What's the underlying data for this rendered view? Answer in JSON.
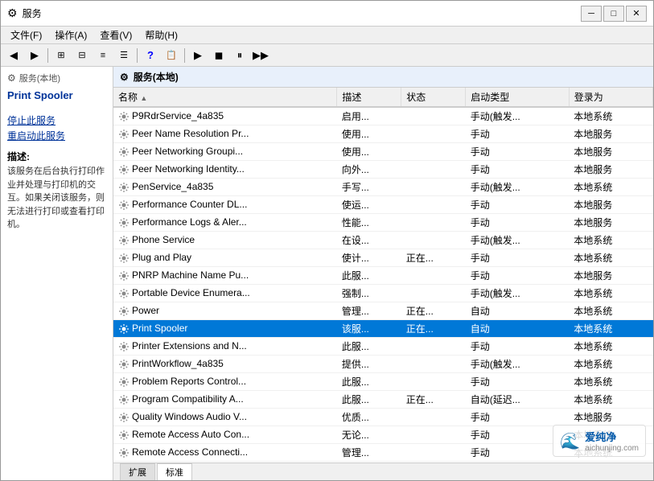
{
  "window": {
    "title": "服务",
    "icon": "⚙"
  },
  "titlebar": {
    "minimize": "─",
    "maximize": "□",
    "close": "✕"
  },
  "menu": {
    "items": [
      "文件(F)",
      "操作(A)",
      "查看(V)",
      "帮助(H)"
    ]
  },
  "sidebar": {
    "header": "服务(本地)",
    "service_title": "Print Spooler",
    "stop_link": "停止此服务",
    "restart_link": "重启动此服务",
    "desc_label": "描述:",
    "desc_text": "该服务在后台执行打印作业并处理与打印机的交互。如果关闭该服务，则无法进行打印或查看打印机。"
  },
  "panel_header": "服务(本地)",
  "columns": [
    "名称",
    "描述",
    "状态",
    "启动类型",
    "登录为"
  ],
  "services": [
    {
      "name": "P9RdrService_4a835",
      "desc": "启用...",
      "status": "",
      "startup": "手动(触发...",
      "login": "本地系统"
    },
    {
      "name": "Peer Name Resolution Pr...",
      "desc": "使用...",
      "status": "",
      "startup": "手动",
      "login": "本地服务"
    },
    {
      "name": "Peer Networking Groupi...",
      "desc": "使用...",
      "status": "",
      "startup": "手动",
      "login": "本地服务"
    },
    {
      "name": "Peer Networking Identity...",
      "desc": "向外...",
      "status": "",
      "startup": "手动",
      "login": "本地服务"
    },
    {
      "name": "PenService_4a835",
      "desc": "手写...",
      "status": "",
      "startup": "手动(触发...",
      "login": "本地系统"
    },
    {
      "name": "Performance Counter DL...",
      "desc": "使运...",
      "status": "",
      "startup": "手动",
      "login": "本地服务"
    },
    {
      "name": "Performance Logs & Aler...",
      "desc": "性能...",
      "status": "",
      "startup": "手动",
      "login": "本地服务"
    },
    {
      "name": "Phone Service",
      "desc": "在设...",
      "status": "",
      "startup": "手动(触发...",
      "login": "本地系统"
    },
    {
      "name": "Plug and Play",
      "desc": "使计...",
      "status": "正在...",
      "startup": "手动",
      "login": "本地系统"
    },
    {
      "name": "PNRP Machine Name Pu...",
      "desc": "此服...",
      "status": "",
      "startup": "手动",
      "login": "本地服务"
    },
    {
      "name": "Portable Device Enumera...",
      "desc": "强制...",
      "status": "",
      "startup": "手动(触发...",
      "login": "本地系统"
    },
    {
      "name": "Power",
      "desc": "管理...",
      "status": "正在...",
      "startup": "自动",
      "login": "本地系统"
    },
    {
      "name": "Print Spooler",
      "desc": "该服...",
      "status": "正在...",
      "startup": "自动",
      "login": "本地系统",
      "selected": true
    },
    {
      "name": "Printer Extensions and N...",
      "desc": "此服...",
      "status": "",
      "startup": "手动",
      "login": "本地系统"
    },
    {
      "name": "PrintWorkflow_4a835",
      "desc": "提供...",
      "status": "",
      "startup": "手动(触发...",
      "login": "本地系统"
    },
    {
      "name": "Problem Reports Control...",
      "desc": "此服...",
      "status": "",
      "startup": "手动",
      "login": "本地系统"
    },
    {
      "name": "Program Compatibility A...",
      "desc": "此服...",
      "status": "正在...",
      "startup": "自动(延迟...",
      "login": "本地系统"
    },
    {
      "name": "Quality Windows Audio V...",
      "desc": "优质...",
      "status": "",
      "startup": "手动",
      "login": "本地服务"
    },
    {
      "name": "Remote Access Auto Con...",
      "desc": "无论...",
      "status": "",
      "startup": "手动",
      "login": "本地系统"
    },
    {
      "name": "Remote Access Connecti...",
      "desc": "管理...",
      "status": "",
      "startup": "手动",
      "login": "本地系统"
    }
  ],
  "tabs": [
    {
      "label": "扩展",
      "active": false
    },
    {
      "label": "标准",
      "active": true
    }
  ],
  "watermark": "爱纯净\naichunjing.com"
}
